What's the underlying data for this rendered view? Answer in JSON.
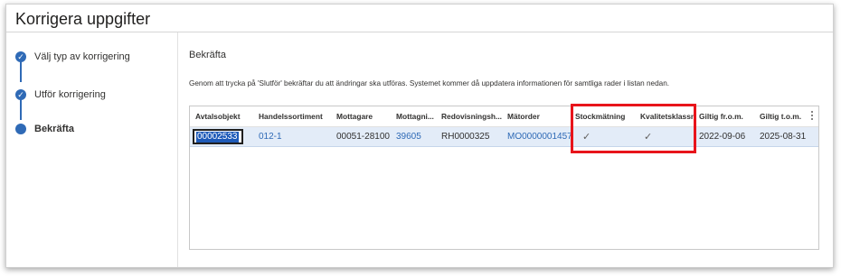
{
  "dialog": {
    "title": "Korrigera uppgifter"
  },
  "steps": [
    {
      "label": "Välj typ av korrigering",
      "state": "done"
    },
    {
      "label": "Utför korrigering",
      "state": "done"
    },
    {
      "label": "Bekräfta",
      "state": "active"
    }
  ],
  "content": {
    "section_title": "Bekräfta",
    "description": "Genom att trycka på 'Slutför' bekräftar du att ändringar ska utföras. Systemet kommer då uppdatera informationen för samtliga rader i listan nedan."
  },
  "grid": {
    "columns": [
      "Avtalsobjekt",
      "Handelssortiment",
      "Mottagare",
      "Mottagni...",
      "Redovisningsh...",
      "Mätorder",
      "Stockmätning",
      "Kvalitetsklassni...",
      "Giltig fr.o.m.",
      "Giltig t.o.m."
    ],
    "rows": [
      [
        "00002533",
        "012-1",
        "00051-28100",
        "39605",
        "RH0000325",
        "MO0000001457",
        "✓",
        "✓",
        "2022-09-06",
        "2025-08-31"
      ]
    ]
  },
  "colors": {
    "accent": "#2f6ab6",
    "highlight": "#e8141b",
    "selected_row": "#e3ecf8"
  },
  "icons": {
    "done_step": "checkmark-icon",
    "more": "more-vertical-icon"
  }
}
